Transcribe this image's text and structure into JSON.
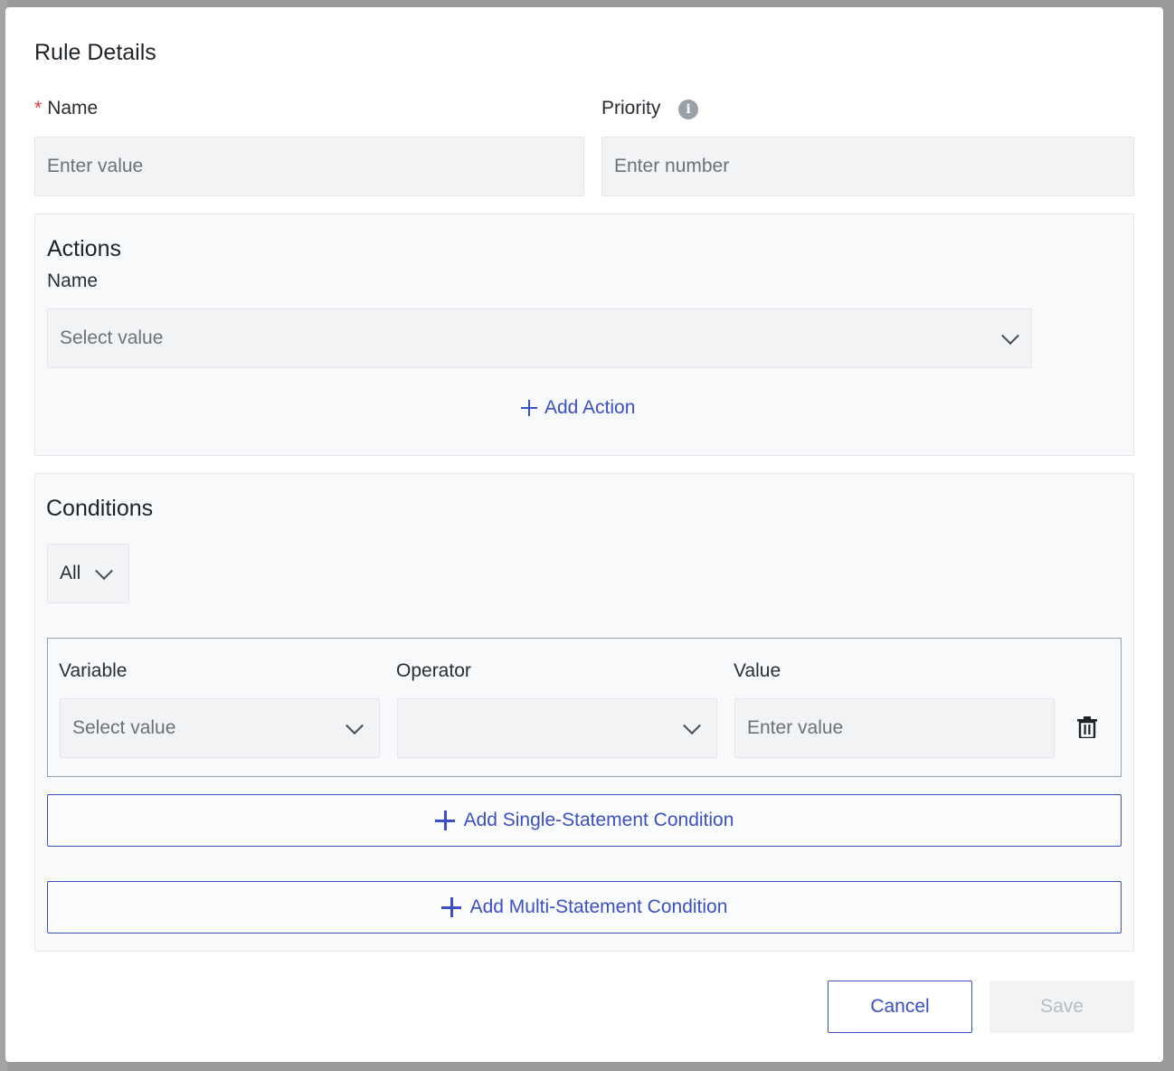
{
  "dialog": {
    "title": "Rule Details",
    "name_label": "Name",
    "name_required_mark": "*",
    "name_placeholder": "Enter value",
    "priority_label": "Priority",
    "priority_info_icon": "info-icon",
    "priority_placeholder": "Enter number"
  },
  "actions": {
    "title": "Actions",
    "name_label": "Name",
    "name_select_value": "Select value",
    "add_action_label": "Add Action"
  },
  "conditions": {
    "title": "Conditions",
    "match_mode": "All",
    "variable_label": "Variable",
    "variable_select_value": "Select value",
    "operator_label": "Operator",
    "operator_select_value": "",
    "value_label": "Value",
    "value_placeholder": "Enter value",
    "delete_icon": "trash-icon",
    "add_single_label": "Add Single-Statement Condition",
    "add_multi_label": "Add Multi-Statement Condition"
  },
  "footer": {
    "cancel_label": "Cancel",
    "save_label": "Save"
  },
  "colors": {
    "accent": "#3b4fc4",
    "required": "#d9363e",
    "field_bg": "#f2f3f5",
    "panel_bg": "#f8f9fb"
  }
}
